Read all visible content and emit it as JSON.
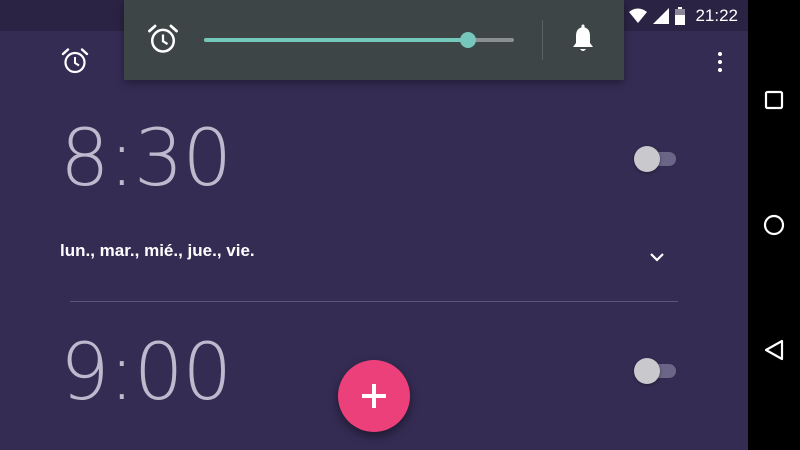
{
  "status_bar": {
    "time": "21:22",
    "icons": [
      "wifi-icon",
      "cell-signal-icon",
      "battery-icon"
    ]
  },
  "app_bar": {
    "icons": [
      "alarm-clock-icon",
      "overflow-menu-icon"
    ]
  },
  "volume_panel": {
    "stream_icon": "alarm-clock-icon",
    "ringer_icon": "bell-icon",
    "level": 0.85,
    "accent_color": "#75c7bb"
  },
  "alarms": [
    {
      "time": "8:30",
      "enabled": false,
      "days": "lun., mar., mié., jue., vie.",
      "expanded_icon": "chevron-down-icon"
    },
    {
      "time": "9:00",
      "enabled": false
    }
  ],
  "fab": {
    "icon": "plus-icon",
    "color": "#ec407a"
  },
  "nav_bar": {
    "buttons": [
      "recents-icon",
      "home-icon",
      "back-icon"
    ]
  },
  "colors": {
    "background": "#352c54",
    "status_bar": "#2a2344",
    "panel": "#3e4547"
  }
}
